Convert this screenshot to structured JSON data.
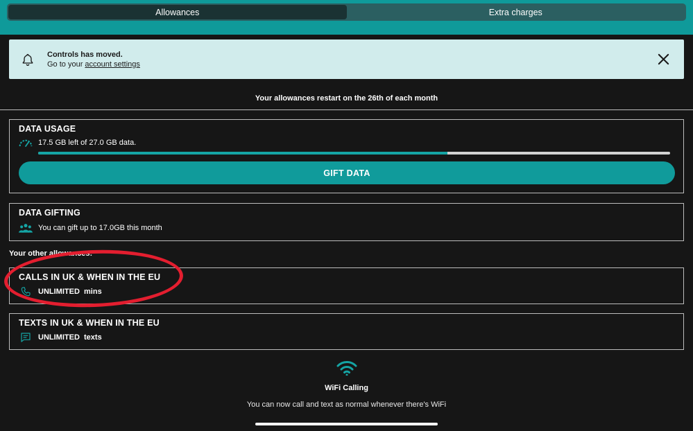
{
  "tabs": [
    {
      "label": "Allowances",
      "active": true
    },
    {
      "label": "Extra charges",
      "active": false
    }
  ],
  "notice": {
    "title": "Controls has moved.",
    "sub_prefix": "Go to your ",
    "link": "account settings"
  },
  "restart_text": "Your allowances restart on the 26th of each month",
  "data_usage": {
    "heading": "DATA USAGE",
    "text": "17.5 GB left of 27.0 GB data.",
    "fraction_left": 0.648,
    "button": "GIFT DATA"
  },
  "data_gifting": {
    "heading": "DATA GIFTING",
    "text": "You can gift up to 17.0GB this month"
  },
  "other_label": "Your other allowances:",
  "calls": {
    "heading": "CALLS IN UK & WHEN IN THE EU",
    "amount": "UNLIMITED",
    "unit": "mins"
  },
  "texts": {
    "heading": "TEXTS IN UK & WHEN IN THE EU",
    "amount": "UNLIMITED",
    "unit": "texts"
  },
  "wifi": {
    "title": "WiFi Calling",
    "sub": "You can now call and text as normal whenever there's WiFi"
  },
  "colors": {
    "accent": "#109b9b",
    "background": "#161616",
    "notice_bg": "#d1ecec",
    "annotation": "#e31e2f"
  },
  "icons": [
    "bell-icon",
    "close-icon",
    "speedometer-icon",
    "group-icon",
    "phone-icon",
    "chat-icon",
    "wifi-icon"
  ]
}
